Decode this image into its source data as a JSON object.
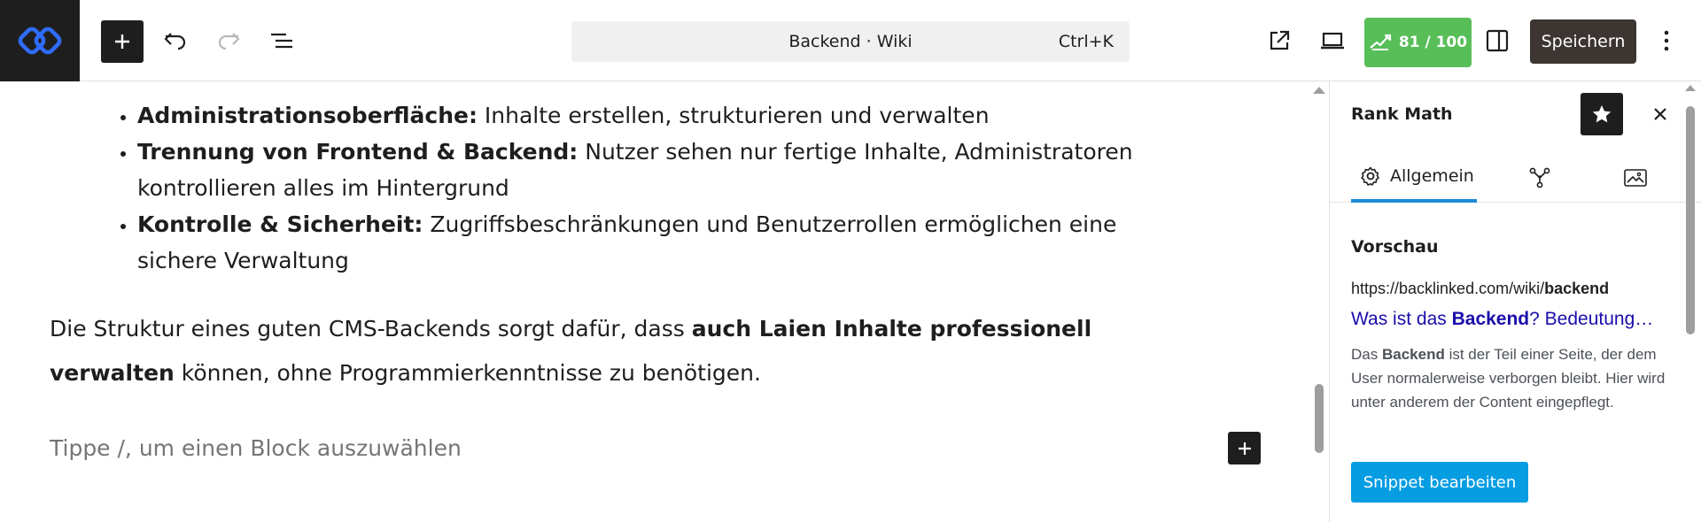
{
  "toolbar": {
    "command_title": "Backend · Wiki",
    "command_shortcut": "Ctrl+K",
    "seo_score": "81 / 100",
    "save_label": "Speichern"
  },
  "content": {
    "list": [
      {
        "bold": "Administrationsoberfläche:",
        "text": " Inhalte erstellen, strukturieren und verwalten"
      },
      {
        "bold": "Trennung von Frontend & Backend:",
        "text": " Nutzer sehen nur fertige Inhalte, Administratoren kontrollieren alles im Hintergrund"
      },
      {
        "bold": "Kontrolle & Sicherheit:",
        "text": " Zugriffsbeschränkungen und Benutzerrollen ermöglichen eine sichere Verwaltung"
      }
    ],
    "paragraph": {
      "before": "Die Struktur eines guten CMS-Backends sorgt dafür, dass ",
      "bold": "auch Laien Inhalte professionell verwalten",
      "after": " können, ohne Programmierkenntnisse zu benötigen."
    },
    "placeholder": "Tippe /, um einen Block auszuwählen"
  },
  "sidebar": {
    "title": "Rank Math",
    "tabs": [
      {
        "label": "Allgemein"
      }
    ],
    "preview_label": "Vorschau",
    "serp": {
      "url_prefix": "https://backlinked.com/wiki/",
      "url_bold": "backend",
      "title_before": "Was ist das ",
      "title_bold": "Backend",
      "title_after": "? Bedeutung & Funktion",
      "desc_before": "Das ",
      "desc_bold": "Backend",
      "desc_after": " ist der Teil einer Seite, der dem User normalerweise verborgen bleibt. Hier wird unter anderem der Content eingepflegt."
    },
    "snippet_button": "Snippet bearbeiten"
  },
  "colors": {
    "score_green": "#58be58",
    "save_dark": "#3c3532",
    "accent_blue": "#069de3",
    "serp_link": "#1a0dab"
  }
}
